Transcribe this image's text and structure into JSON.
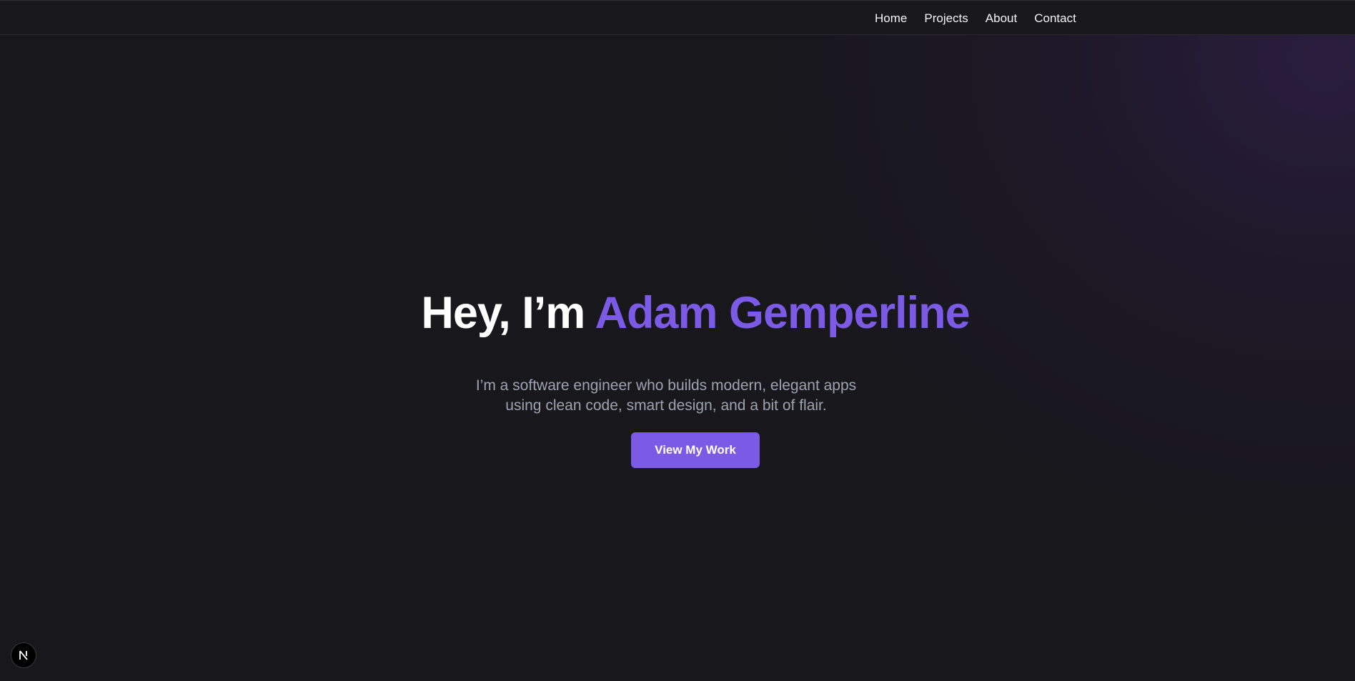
{
  "nav": {
    "items": [
      {
        "label": "Home"
      },
      {
        "label": "Projects"
      },
      {
        "label": "About"
      },
      {
        "label": "Contact"
      }
    ]
  },
  "hero": {
    "greeting": "Hey, I’m ",
    "name": "Adam Gemperline",
    "subtitle_line1": "I’m a software engineer who builds modern, elegant apps",
    "subtitle_line2": "using clean code, smart design, and a bit of flair.",
    "cta_label": "View My Work"
  },
  "dev_badge": {
    "icon": "nextjs-logo-icon"
  },
  "colors": {
    "background": "#18171c",
    "accent": "#7b5be6",
    "heading": "#ffffff",
    "subtitle": "#9da3b0",
    "nav_text": "#f4f4f6"
  }
}
